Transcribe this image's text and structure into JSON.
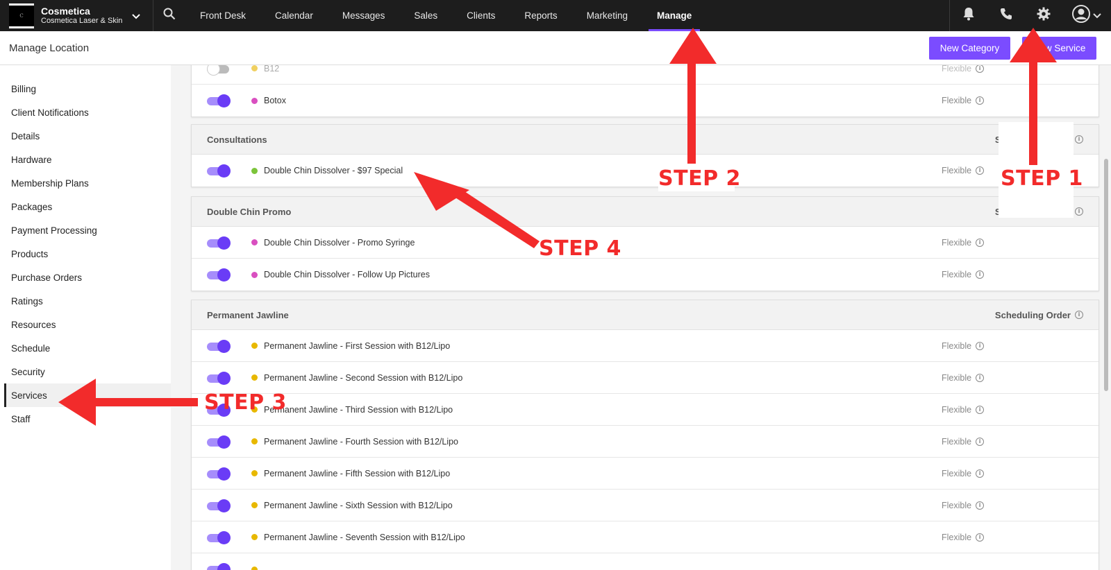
{
  "brand": {
    "name": "Cosmetica",
    "subtitle": "Cosmetica Laser & Skin",
    "logo_text": "C"
  },
  "nav": {
    "items": [
      {
        "label": "Front Desk"
      },
      {
        "label": "Calendar"
      },
      {
        "label": "Messages"
      },
      {
        "label": "Sales"
      },
      {
        "label": "Clients"
      },
      {
        "label": "Reports"
      },
      {
        "label": "Marketing"
      },
      {
        "label": "Manage",
        "active": true
      }
    ]
  },
  "header": {
    "title": "Manage Location",
    "new_category_label": "New Category",
    "new_service_label": "New Service"
  },
  "sidebar": {
    "items": [
      {
        "label": "Billing"
      },
      {
        "label": "Client Notifications"
      },
      {
        "label": "Details"
      },
      {
        "label": "Hardware"
      },
      {
        "label": "Membership Plans"
      },
      {
        "label": "Packages"
      },
      {
        "label": "Payment Processing"
      },
      {
        "label": "Products"
      },
      {
        "label": "Purchase Orders"
      },
      {
        "label": "Ratings"
      },
      {
        "label": "Resources"
      },
      {
        "label": "Schedule"
      },
      {
        "label": "Security"
      },
      {
        "label": "Services",
        "active": true
      },
      {
        "label": "Staff"
      }
    ]
  },
  "labels": {
    "scheduling_order": "Scheduling Order",
    "flexible": "Flexible"
  },
  "categories": [
    {
      "name": "",
      "services": [
        {
          "name": "B12",
          "enabled": false,
          "color": "#f0d060"
        },
        {
          "name": "Botox",
          "enabled": true,
          "color": "#d94fc0"
        }
      ]
    },
    {
      "name": "Consultations",
      "services": [
        {
          "name": "Double Chin Dissolver - $97 Special",
          "enabled": true,
          "color": "#7cc43a"
        }
      ]
    },
    {
      "name": "Double Chin Promo",
      "services": [
        {
          "name": "Double Chin Dissolver - Promo Syringe",
          "enabled": true,
          "color": "#d94fc0"
        },
        {
          "name": "Double Chin Dissolver - Follow Up Pictures",
          "enabled": true,
          "color": "#d94fc0"
        }
      ]
    },
    {
      "name": "Permanent Jawline",
      "services": [
        {
          "name": "Permanent Jawline - First Session with B12/Lipo",
          "enabled": true,
          "color": "#e8b800"
        },
        {
          "name": "Permanent Jawline - Second Session with B12/Lipo",
          "enabled": true,
          "color": "#e8b800"
        },
        {
          "name": "Permanent Jawline - Third Session with B12/Lipo",
          "enabled": true,
          "color": "#e8b800"
        },
        {
          "name": "Permanent Jawline - Fourth Session with B12/Lipo",
          "enabled": true,
          "color": "#e8b800"
        },
        {
          "name": "Permanent Jawline - Fifth Session with B12/Lipo",
          "enabled": true,
          "color": "#e8b800"
        },
        {
          "name": "Permanent Jawline - Sixth Session with B12/Lipo",
          "enabled": true,
          "color": "#e8b800"
        },
        {
          "name": "Permanent Jawline - Seventh Session with B12/Lipo",
          "enabled": true,
          "color": "#e8b800"
        }
      ]
    }
  ],
  "annotations": {
    "step1": "STEP 1",
    "step2": "STEP 2",
    "step3": "STEP 3",
    "step4": "STEP 4",
    "color": "#f22b2b"
  },
  "colors": {
    "accent": "#7b4cff",
    "topbar": "#1d1d1d"
  }
}
